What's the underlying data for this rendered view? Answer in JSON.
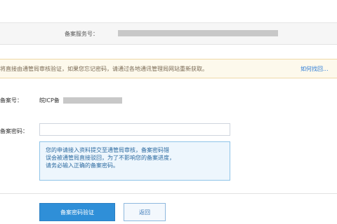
{
  "top_bar": {
    "label": "备案服务号："
  },
  "notice": {
    "text": "将直接由通管局审核验证，如果您忘记密码，请通过各地通讯管理局网站重新获取。",
    "link": "如何找回..."
  },
  "record_number": {
    "label": "备案号：",
    "value_prefix": "皖ICP备"
  },
  "record_password": {
    "label": "备案密码：",
    "value": "",
    "placeholder": ""
  },
  "help_text": {
    "lines": [
      "您的申请接入资料提交至通管局审核，备案密码错",
      "误会被通管局直接驳回，为了不影响您的备案进度，",
      "请务必输入正确的备案密码。"
    ]
  },
  "buttons": {
    "verify": "备案密码验证",
    "back": "返回"
  },
  "colors": {
    "accent": "#2f8fd8",
    "link": "#2b7bd6",
    "notice_bg": "#fdf9ec",
    "help_bg": "#edf6fd"
  }
}
